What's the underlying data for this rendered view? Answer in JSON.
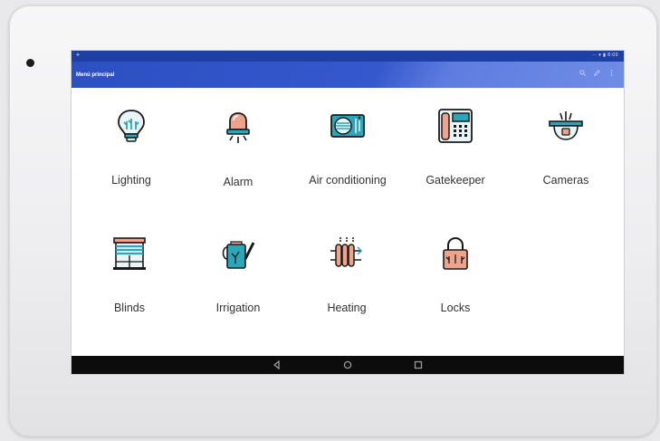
{
  "app": {
    "title": "Menú principal",
    "status_left": "✈",
    "status_right": "⋯ ▾ ▮ 8:00"
  },
  "tiles": [
    {
      "label": "Lighting",
      "icon": "lightbulb-icon"
    },
    {
      "label": "Alarm",
      "icon": "siren-icon"
    },
    {
      "label": "Air conditioning",
      "icon": "air-conditioner-icon"
    },
    {
      "label": "Gatekeeper",
      "icon": "intercom-phone-icon"
    },
    {
      "label": "Cameras",
      "icon": "dome-camera-icon"
    },
    {
      "label": "Blinds",
      "icon": "window-blinds-icon"
    },
    {
      "label": "Irrigation",
      "icon": "watering-can-icon"
    },
    {
      "label": "Heating",
      "icon": "radiator-icon"
    },
    {
      "label": "Locks",
      "icon": "padlock-icon"
    }
  ],
  "navbar": {
    "buttons": [
      "back",
      "home",
      "recents"
    ]
  },
  "colors": {
    "statusbar": "#1e3fa4",
    "appbar": "#2c4fc2",
    "icon_teal": "#2aa7b8",
    "icon_salmon": "#f0a38c",
    "icon_outline": "#1a1a1a"
  }
}
